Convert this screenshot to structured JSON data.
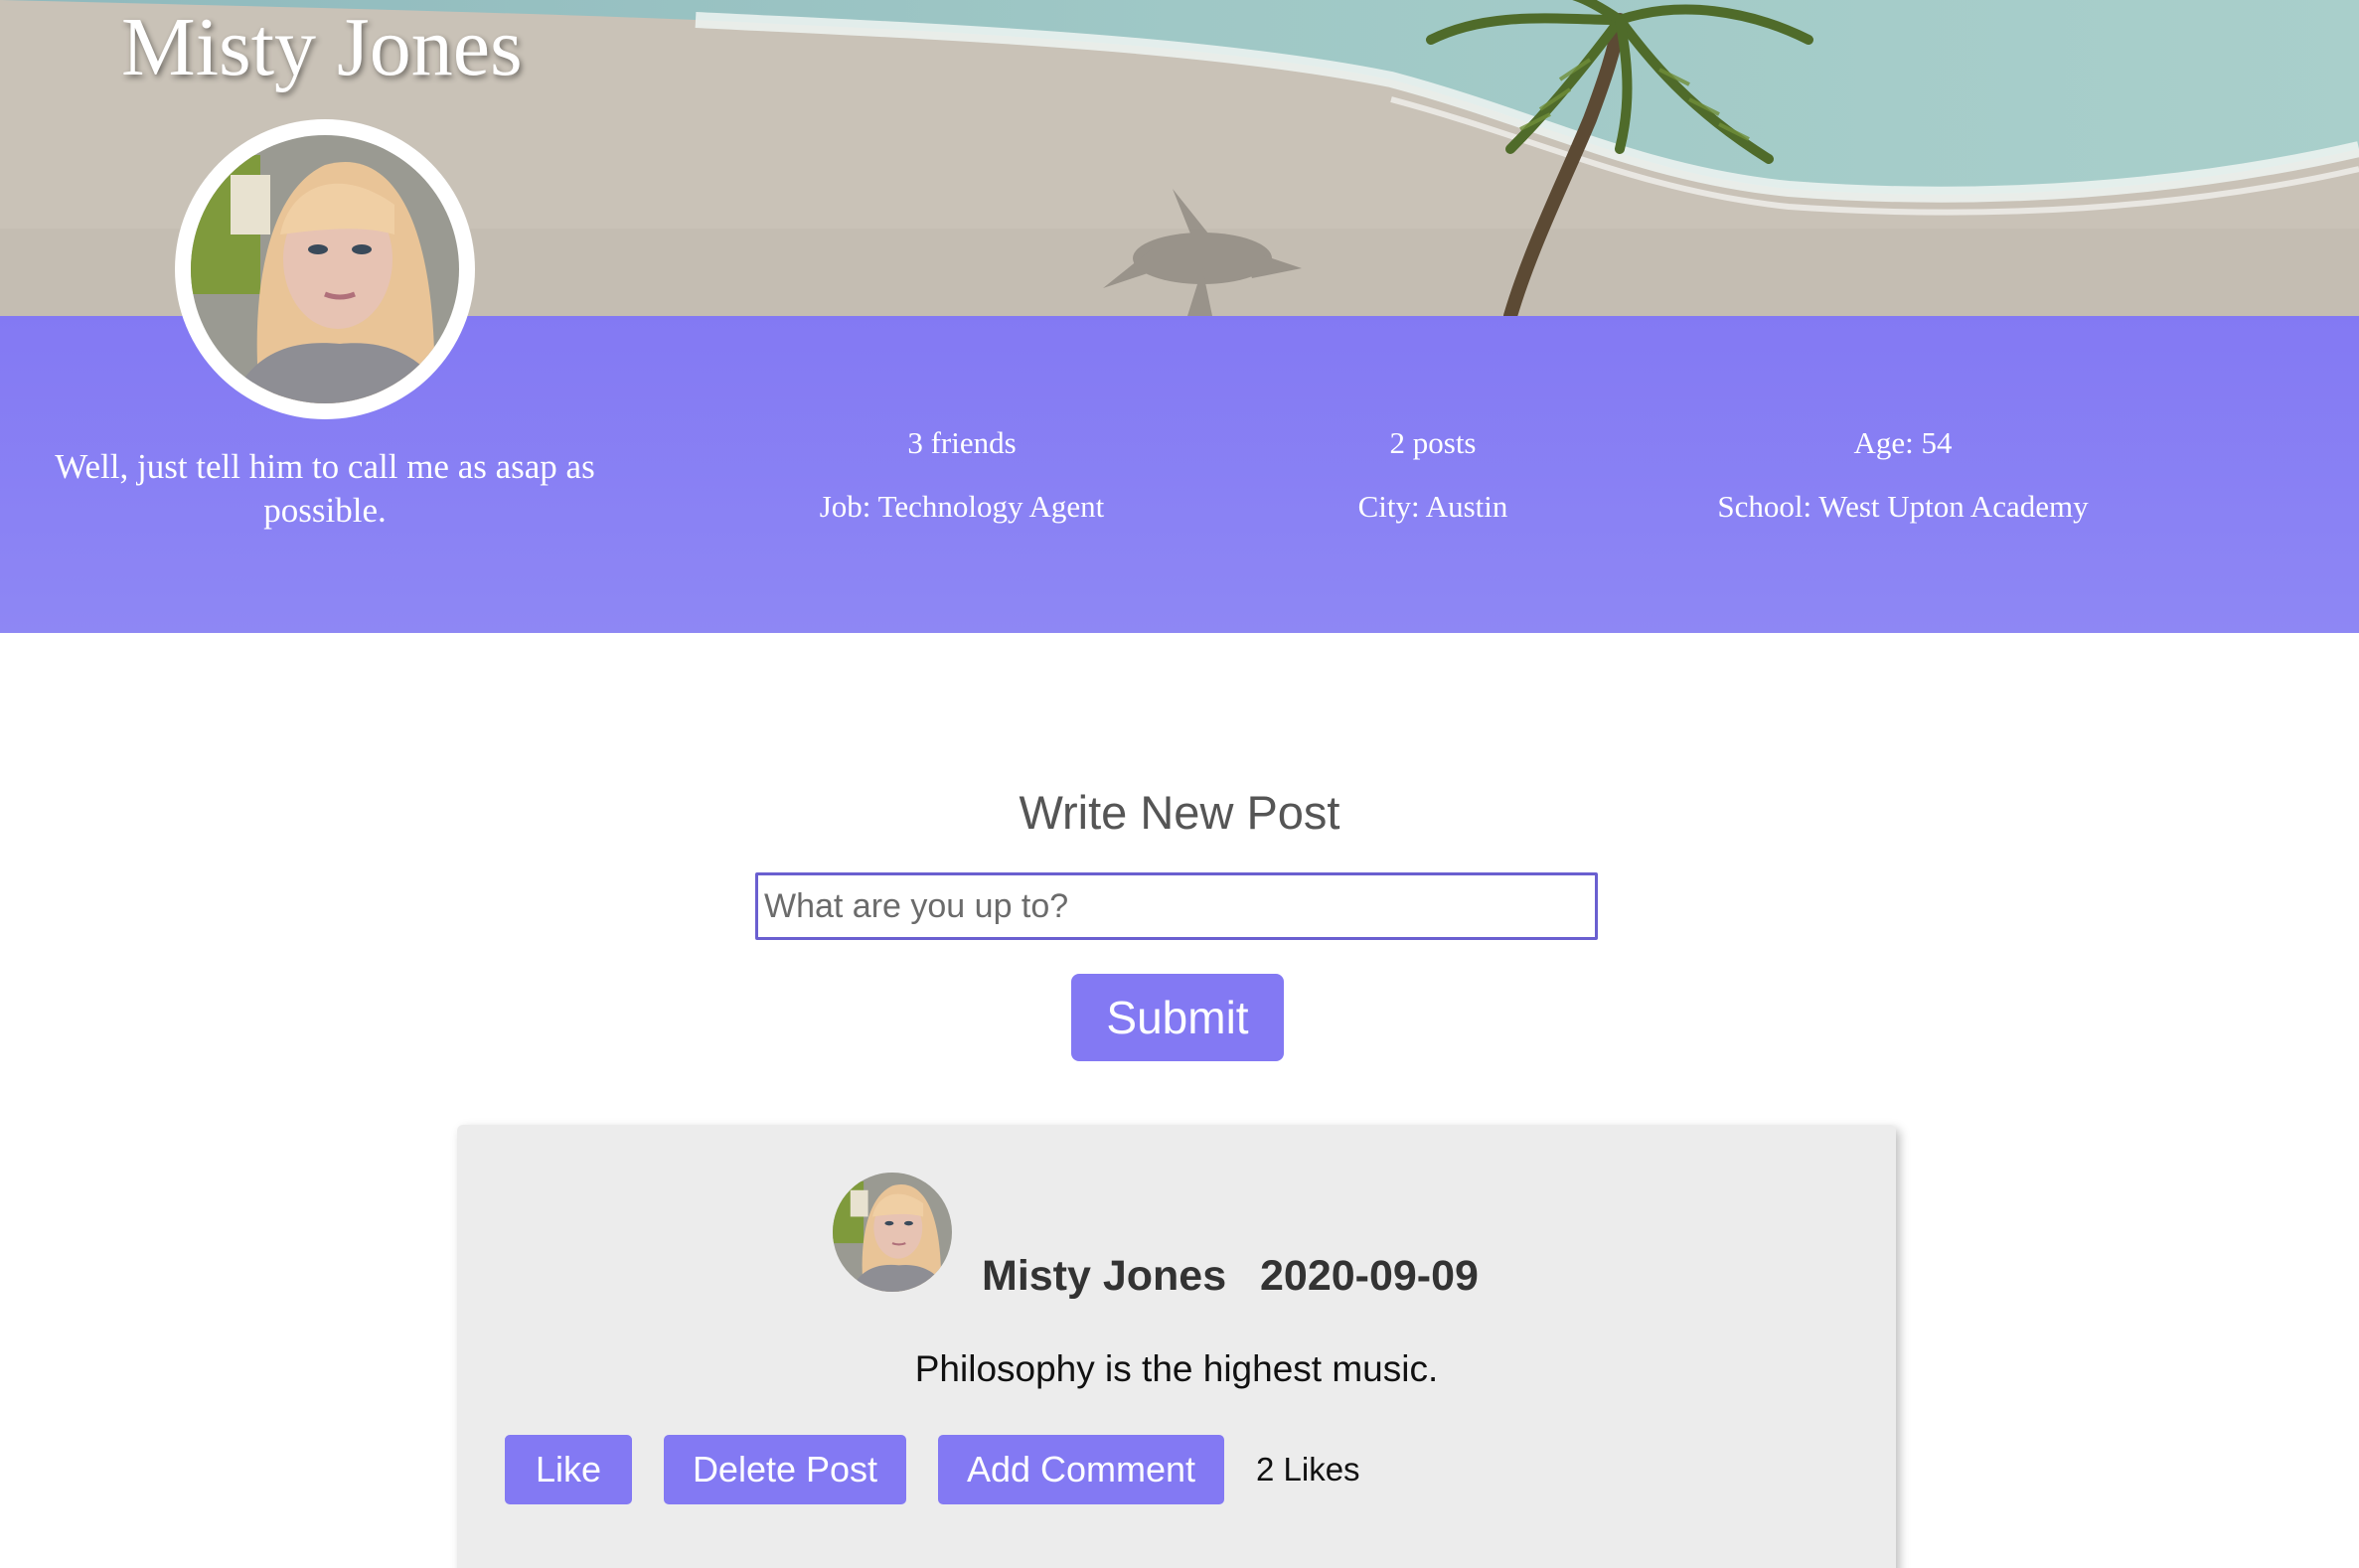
{
  "profile": {
    "name": "Misty Jones",
    "bio": "Well, just tell him to call me as asap as possible.",
    "stats": {
      "friends": "3 friends",
      "posts": "2 posts",
      "age": "Age: 54",
      "job": "Job: Technology Agent",
      "city": "City: Austin",
      "school": "School: West Upton Academy"
    }
  },
  "compose": {
    "title": "Write New Post",
    "placeholder": "What are you up to?",
    "value": "",
    "submit_label": "Submit"
  },
  "posts": [
    {
      "author": "Misty Jones",
      "date": "2020-09-09",
      "text": "Philosophy is the highest music.",
      "actions": {
        "like": "Like",
        "delete": "Delete Post",
        "comment": "Add Comment"
      },
      "likes": "2 Likes"
    }
  ],
  "colors": {
    "accent": "#8379f3",
    "input_border": "#6a5fd0",
    "card_background": "#ececec"
  },
  "icons": {
    "cover": "beach-palm-cover-image",
    "avatar": "profile-photo-avatar"
  }
}
